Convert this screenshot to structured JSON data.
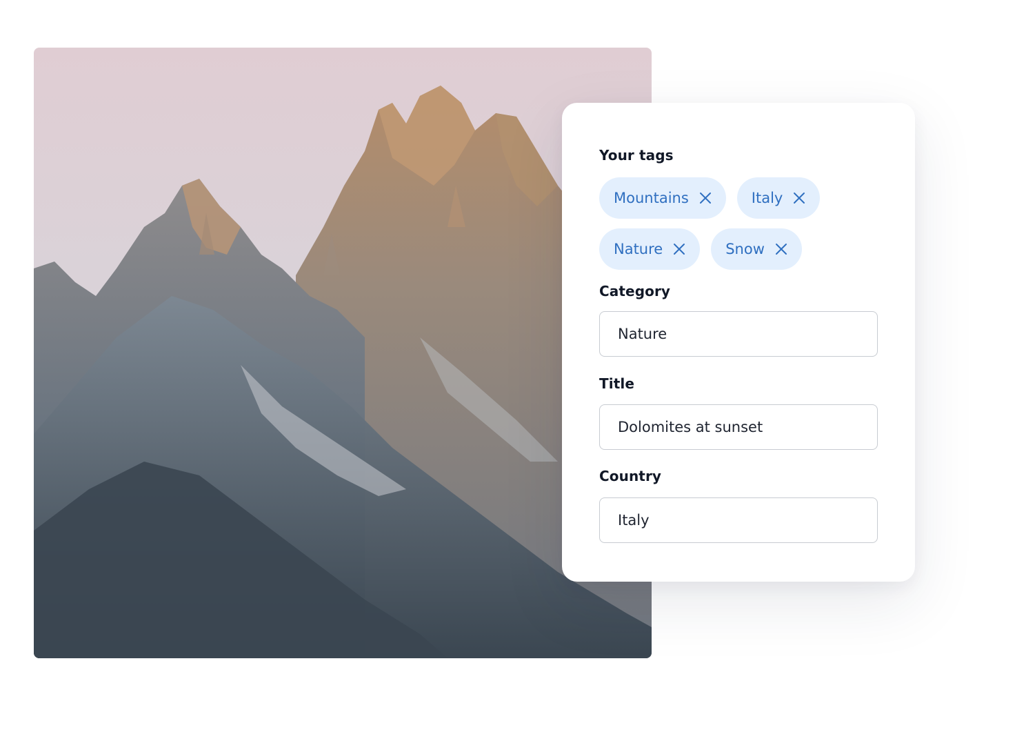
{
  "photo": {
    "description_icon": "mountain-photo"
  },
  "form": {
    "tags_label": "Your tags",
    "tags": [
      {
        "label": "Mountains",
        "remove_icon": "close-icon"
      },
      {
        "label": "Italy",
        "remove_icon": "close-icon"
      },
      {
        "label": "Nature",
        "remove_icon": "close-icon"
      },
      {
        "label": "Snow",
        "remove_icon": "close-icon"
      }
    ],
    "category": {
      "label": "Category",
      "value": "Nature"
    },
    "title": {
      "label": "Title",
      "value": "Dolomites at sunset"
    },
    "country": {
      "label": "Country",
      "value": "Italy"
    }
  },
  "colors": {
    "tag_background": "#e3effd",
    "tag_text": "#2f6fc0",
    "label_text": "#111827",
    "field_border": "#c7cbd1"
  }
}
